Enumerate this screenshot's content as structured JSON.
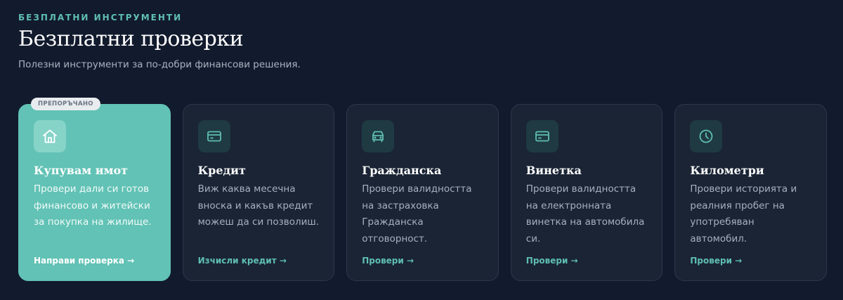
{
  "header": {
    "eyebrow": "БЕЗПЛАТНИ ИНСТРУМЕНТИ",
    "title": "Безплатни проверки",
    "subtitle": "Полезни инструменти за по-добри финансови решения."
  },
  "cards": [
    {
      "badge": "ПРЕПОРЪЧАНО",
      "icon": "home-icon",
      "title": "Купувам имот",
      "description": "Провери дали си готов финансово и житейски за покупка на жилище.",
      "link": "Направи проверка →"
    },
    {
      "icon": "credit-card-icon",
      "title": "Кредит",
      "description": "Виж каква месечна вноска и какъв кредит можеш да си позволиш.",
      "link": "Изчисли кредит →"
    },
    {
      "icon": "car-icon",
      "title": "Гражданска",
      "description": "Провери валидността на застраховка Гражданска отговорност.",
      "link": "Провери →"
    },
    {
      "icon": "card-icon",
      "title": "Винетка",
      "description": "Провери валидността на електронната винетка на автомобила си.",
      "link": "Провери →"
    },
    {
      "icon": "clock-icon",
      "title": "Километри",
      "description": "Провери историята и реалния пробег на употребяван автомобил.",
      "link": "Провери →"
    }
  ],
  "colors": {
    "accent": "#5fbfb1",
    "featured_card": "#61c2b5",
    "background": "#121a2d",
    "card": "#1a2435"
  }
}
